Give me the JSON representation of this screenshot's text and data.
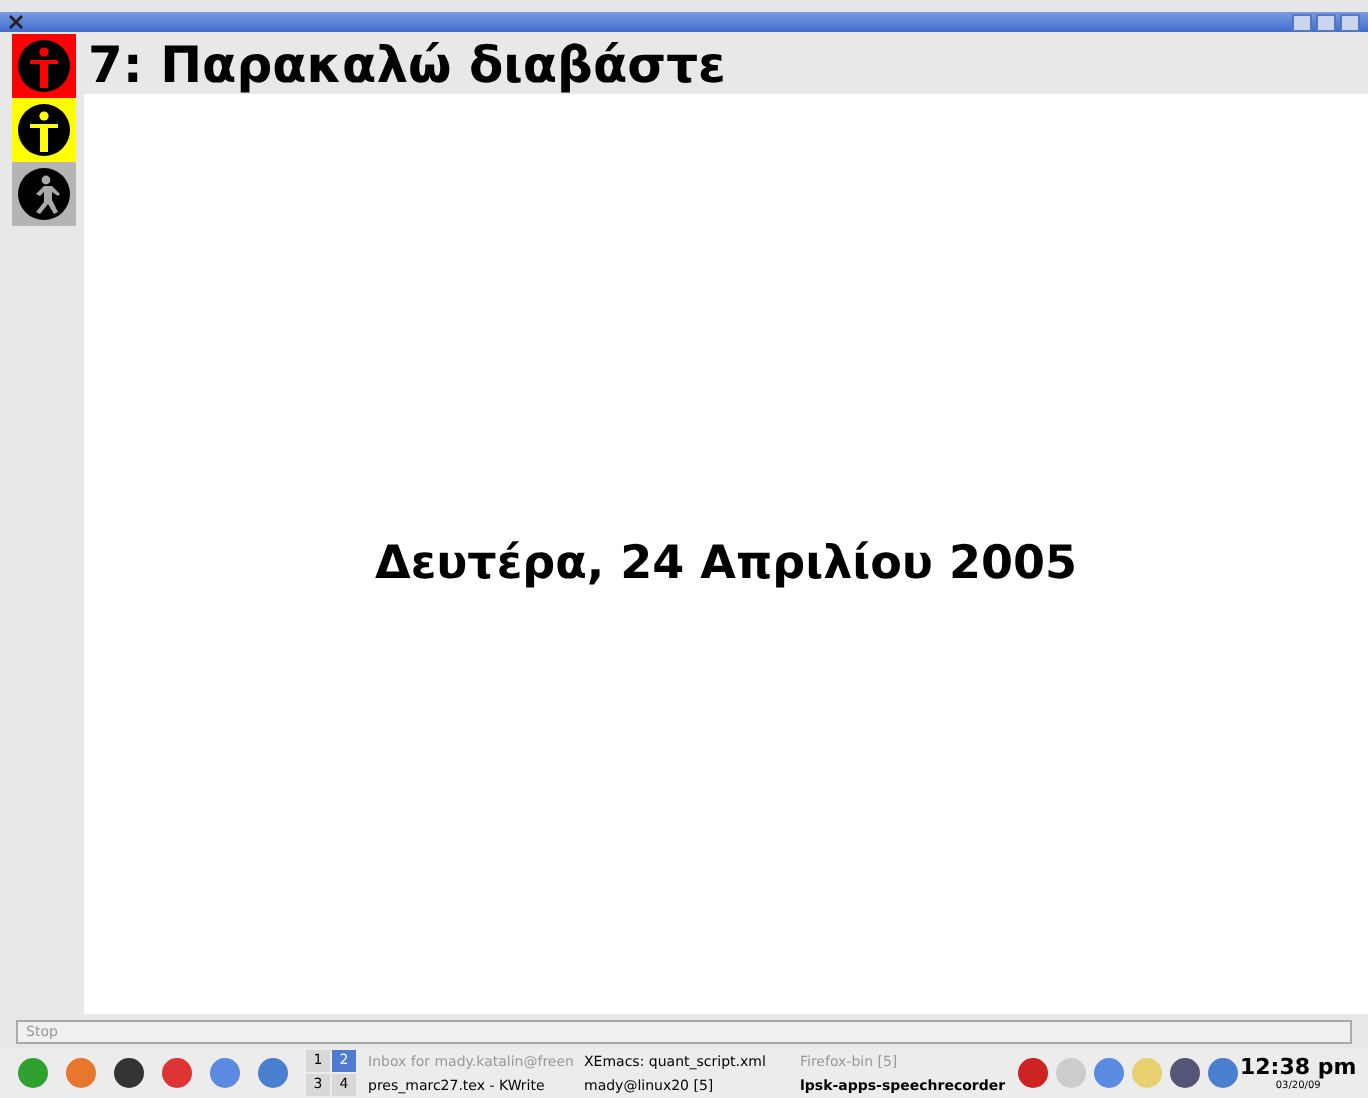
{
  "window": {
    "title": "7: Παρακαλώ διαβάστε"
  },
  "signals": [
    {
      "kind": "stand",
      "color": "#ff0000"
    },
    {
      "kind": "stand",
      "color": "#ffff00"
    },
    {
      "kind": "walk",
      "color": "#b4b4b4"
    }
  ],
  "content": {
    "text": "Δευτέρα, 24 Απριλίου 2005"
  },
  "stop_button": {
    "label": "Stop",
    "disabled": true
  },
  "taskbar": {
    "desktops": [
      {
        "label": "1",
        "selected": false
      },
      {
        "label": "2",
        "selected": true
      },
      {
        "label": "3",
        "selected": false
      },
      {
        "label": "4",
        "selected": false
      }
    ],
    "tasks": [
      {
        "label": "Inbox for mady.katalin@freen",
        "minimized": true,
        "active": false
      },
      {
        "label": "XEmacs: quant_script.xml",
        "minimized": false,
        "active": false
      },
      {
        "label": "Firefox-bin [5]",
        "minimized": true,
        "active": false
      },
      {
        "label": "pres_marc27.tex - KWrite",
        "minimized": false,
        "active": false
      },
      {
        "label": "mady@linux20 [5]",
        "minimized": false,
        "active": false
      },
      {
        "label": "lpsk-apps-speechrecorder",
        "minimized": false,
        "active": true
      }
    ],
    "clock": {
      "time": "12:38 pm",
      "date": "03/20/09"
    }
  }
}
